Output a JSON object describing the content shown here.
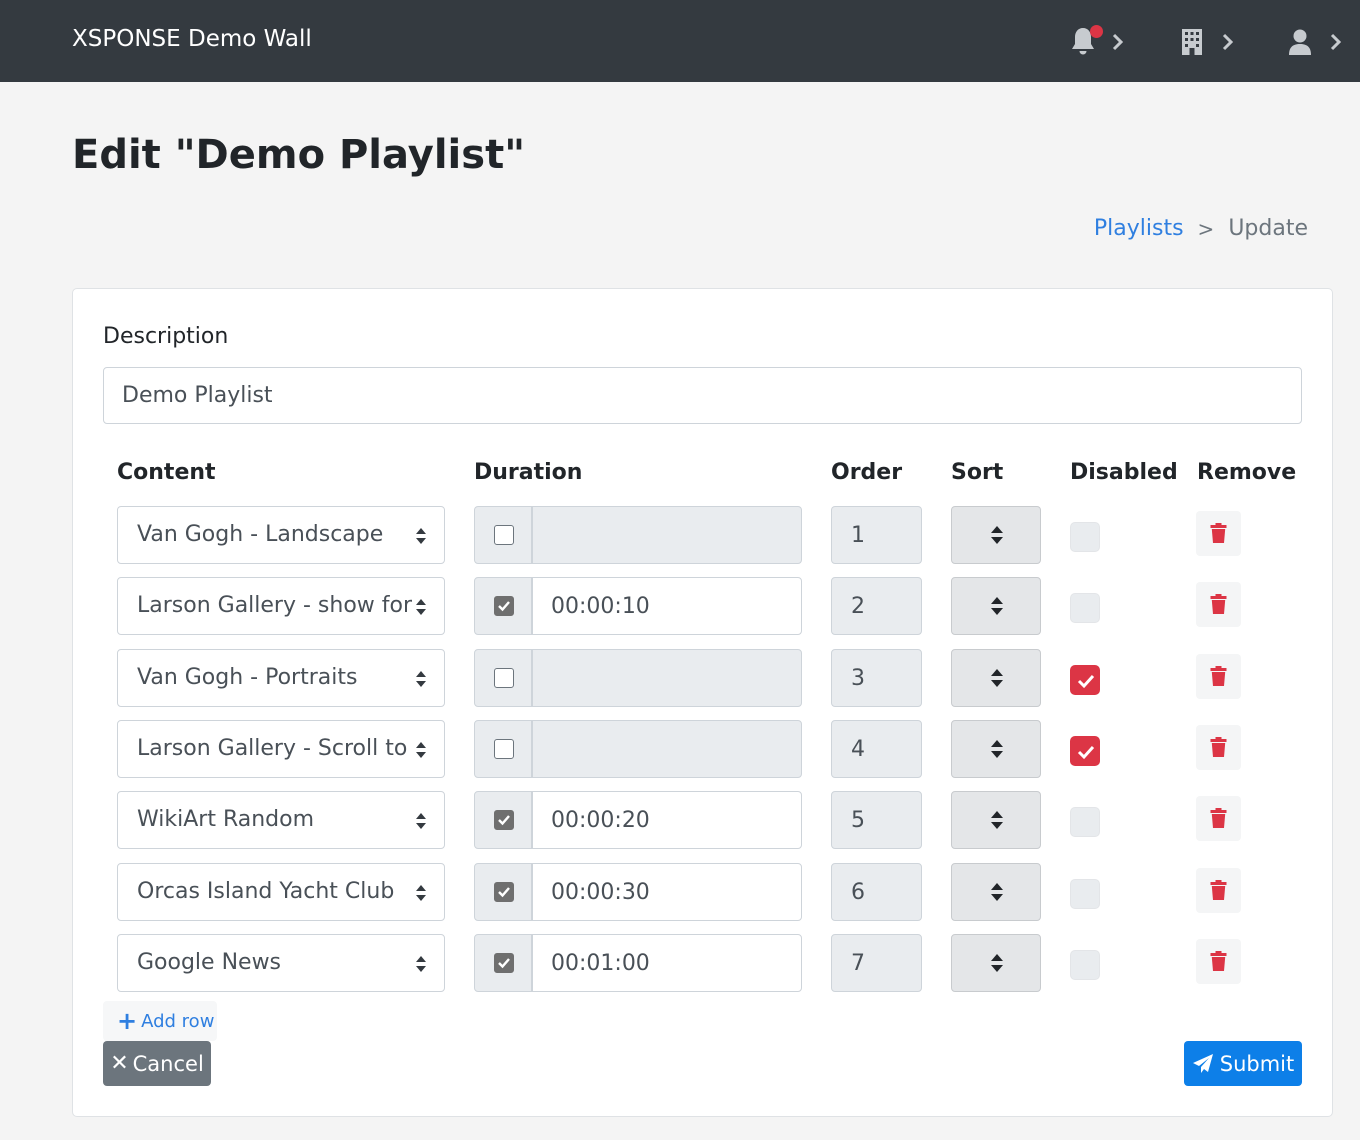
{
  "navbar": {
    "brand": "XSPONSE Demo Wall",
    "icons": [
      "bell-icon",
      "building-icon",
      "user-icon"
    ],
    "notification_badge_color": "#dc3545"
  },
  "page": {
    "title": "Edit \"Demo Playlist\""
  },
  "breadcrumb": {
    "link": "Playlists",
    "separator": ">",
    "current": "Update"
  },
  "form": {
    "description_label": "Description",
    "description_value": "Demo Playlist",
    "headers": {
      "content": "Content",
      "duration": "Duration",
      "order": "Order",
      "sort": "Sort",
      "disabled": "Disabled",
      "remove": "Remove"
    },
    "rows": [
      {
        "content": "Van Gogh - Landscape",
        "duration_enabled": false,
        "duration": "",
        "order": "1",
        "disabled": false
      },
      {
        "content": "Larson Gallery - show for",
        "duration_enabled": true,
        "duration": "00:00:10",
        "order": "2",
        "disabled": false
      },
      {
        "content": "Van Gogh - Portraits",
        "duration_enabled": false,
        "duration": "",
        "order": "3",
        "disabled": true
      },
      {
        "content": "Larson Gallery - Scroll to",
        "duration_enabled": false,
        "duration": "",
        "order": "4",
        "disabled": true
      },
      {
        "content": "WikiArt Random",
        "duration_enabled": true,
        "duration": "00:00:20",
        "order": "5",
        "disabled": false
      },
      {
        "content": "Orcas Island Yacht Club",
        "duration_enabled": true,
        "duration": "00:00:30",
        "order": "6",
        "disabled": false
      },
      {
        "content": "Google News",
        "duration_enabled": true,
        "duration": "00:01:00",
        "order": "7",
        "disabled": false
      }
    ],
    "add_row_label": "Add row",
    "cancel_label": "Cancel",
    "submit_label": "Submit"
  },
  "colors": {
    "primary": "#0d7fe8",
    "danger": "#dc3545",
    "secondary": "#6c757d",
    "navbar_bg": "#343a40"
  }
}
